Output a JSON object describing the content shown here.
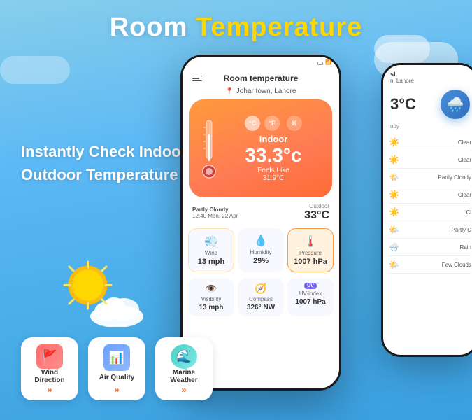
{
  "title": {
    "part1": "Room ",
    "part2": "Temperature"
  },
  "tagline": {
    "line1": "Instantly Check Indoor/",
    "line2": "Outdoor Temperature"
  },
  "main_phone": {
    "app_title": "Room temperature",
    "location": "Johar town, Lahore",
    "indoor_label": "Indoor",
    "indoor_temp": "33.3°c",
    "feels_like_label": "Feels Like",
    "feels_like_temp": "31.9°C",
    "unit_celsius": "°C",
    "unit_fahrenheit": "°F",
    "unit_kelvin": "K",
    "weather_condition": "Partly Cloudy",
    "weather_time": "12:40 Mon, 22 Apr",
    "outdoor_label": "Outdoor",
    "outdoor_temp": "33°C",
    "wind_label": "Wind",
    "wind_value": "13 mph",
    "humidity_label": "Humidity",
    "humidity_value": "29%",
    "pressure_label": "Pressure",
    "pressure_value": "1007 hPa",
    "compass_label": "Compass",
    "compass_value": "326° NW",
    "uv_label": "UV-index",
    "uv_value": "1007 hPa",
    "visibility_label": "Visibility",
    "visibility_value": "13 mph"
  },
  "right_phone": {
    "title": "st",
    "location": "n, Lahore",
    "temp": "3°C",
    "condition": "udy",
    "forecast": [
      {
        "condition": "Clear",
        "icon": "☀️"
      },
      {
        "condition": "Clear",
        "icon": "☀️"
      },
      {
        "condition": "Partly Cloudy",
        "icon": "🌤️"
      },
      {
        "condition": "Clear",
        "icon": "☀️"
      },
      {
        "condition": "Cl",
        "icon": "☀️"
      },
      {
        "condition": "Partly C",
        "icon": "🌤️"
      },
      {
        "condition": "Rain",
        "icon": "🌧️"
      },
      {
        "condition": "Few Clouds",
        "icon": "🌤️"
      }
    ]
  },
  "feature_cards": [
    {
      "label": "Wind Direction",
      "chevron": "»",
      "icon_type": "wind"
    },
    {
      "label": "Air Quality",
      "chevron": "»",
      "icon_type": "air"
    },
    {
      "label": "Marine Weather",
      "chevron": "»",
      "icon_type": "marine"
    }
  ]
}
